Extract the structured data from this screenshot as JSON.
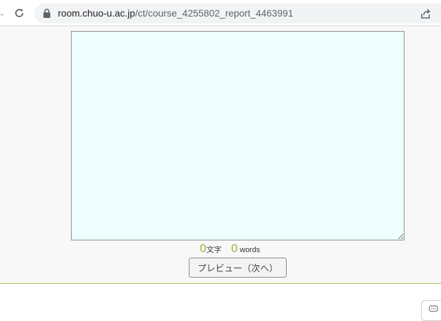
{
  "browser": {
    "url_host": "room.chuo-u.ac.jp",
    "url_path": "/ct/course_4255802_report_4463991"
  },
  "report": {
    "textarea_value": "",
    "char_count": "0",
    "char_unit": "文字",
    "word_count": "0",
    "word_unit": "words",
    "preview_button_label": "プレビュー（次へ）"
  },
  "icons": {
    "forward": "arrow-right-icon",
    "reload": "reload-icon",
    "lock": "lock-icon",
    "share": "share-icon",
    "chat": "chat-bubble-icon"
  },
  "colors": {
    "textarea_bg": "#eefdfd",
    "count_accent": "#8dbb3c",
    "divider": "#9cc35a",
    "page_bg": "#f8f8f8"
  }
}
